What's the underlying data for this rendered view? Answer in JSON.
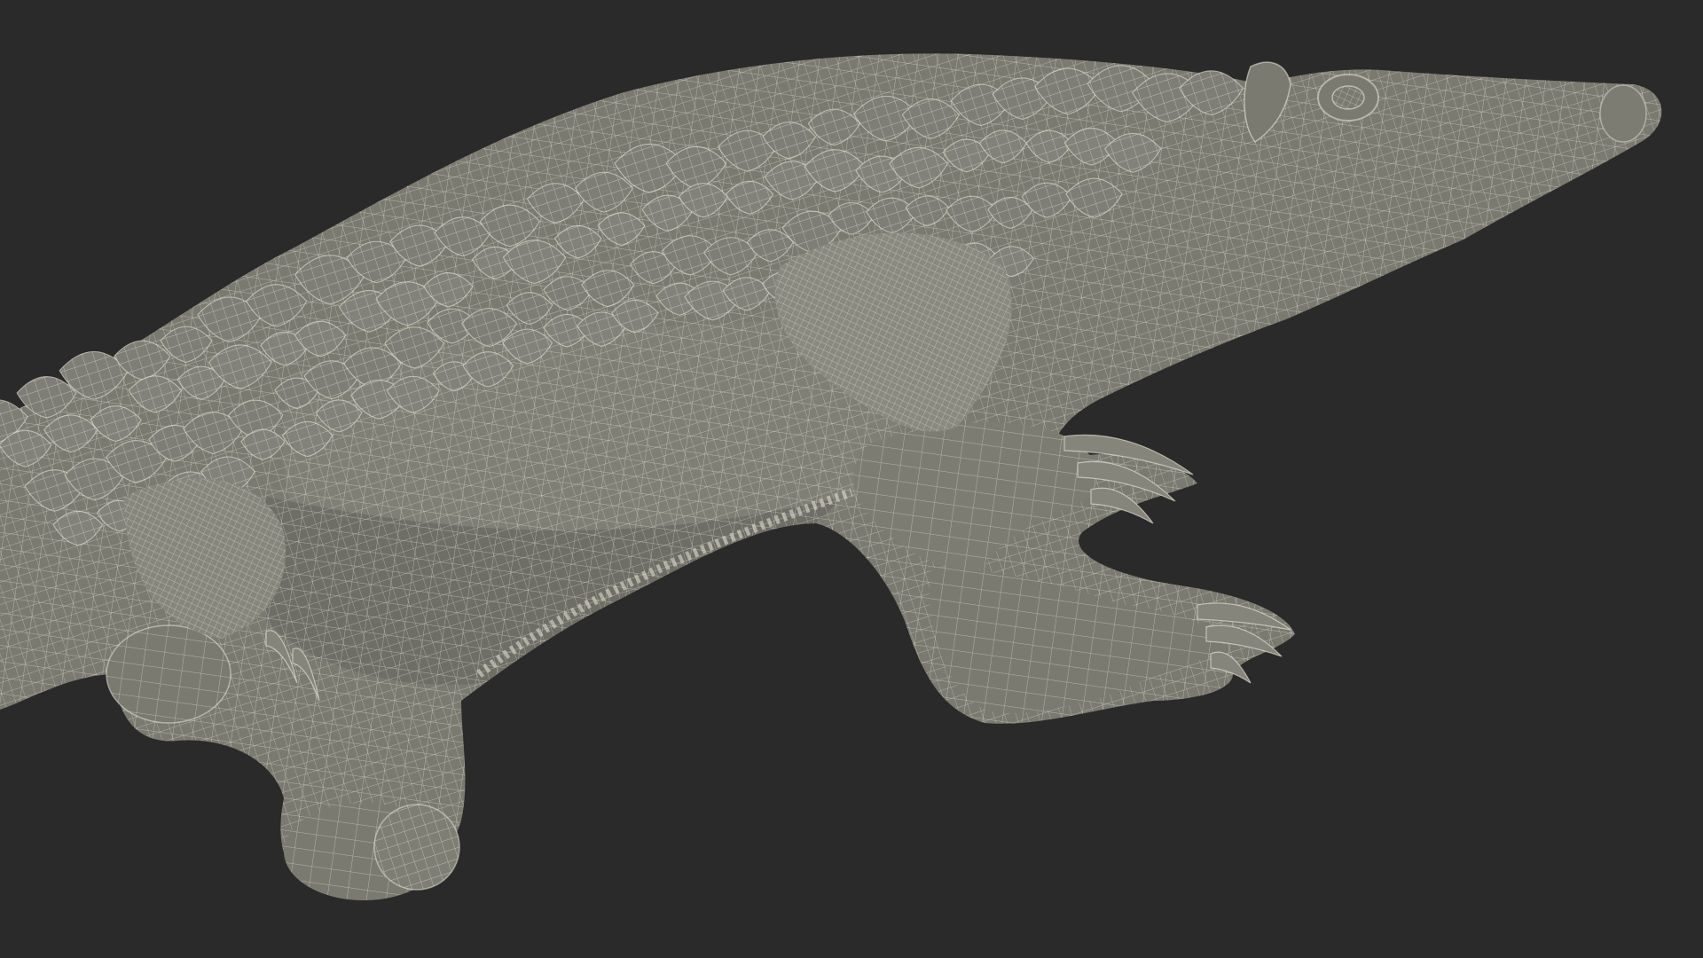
{
  "scene": {
    "subject": "pangolin-wireframe-model",
    "background_color": "#2a2a2a",
    "surface_color": "#7b7a71",
    "shadow_color": "#5e5d56",
    "scale_color": "#85847b",
    "wire_color": "#eeeedf",
    "wire_opacity": 0.55
  }
}
